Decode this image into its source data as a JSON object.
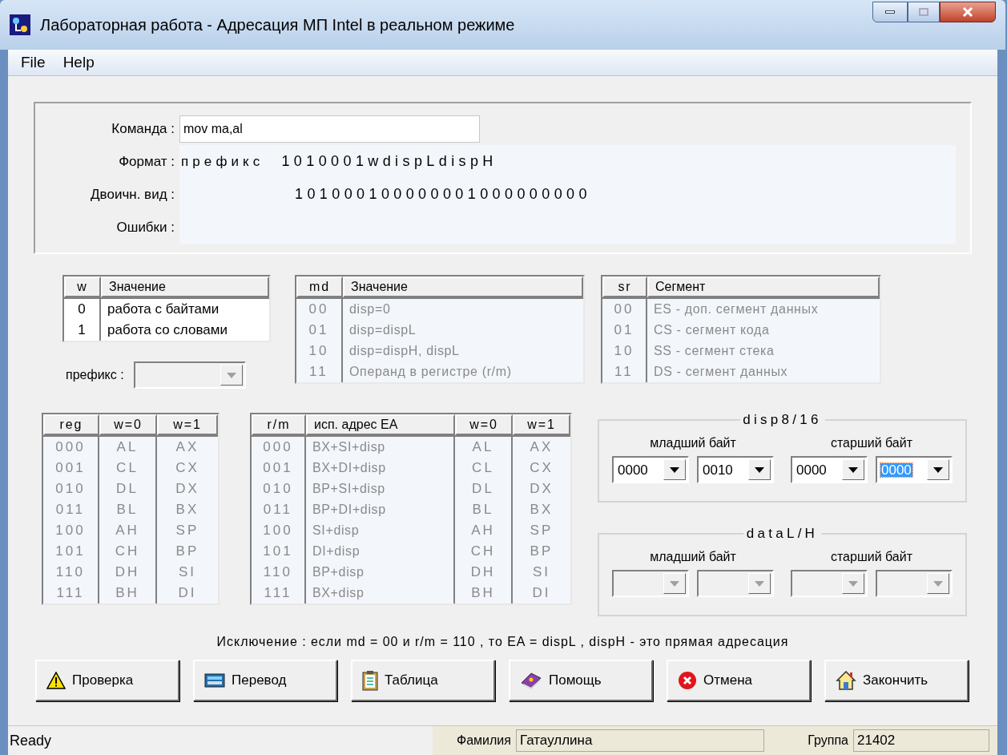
{
  "window": {
    "title": "Лабораторная работа - Адресация МП Intel в реальном режиме"
  },
  "menu": [
    "File",
    "Help"
  ],
  "command": {
    "label": "Команда :",
    "value": "mov ma,al"
  },
  "format": {
    "label": "Формат :",
    "prefix": "префикс",
    "value": "1010001wdispLdispH"
  },
  "binary": {
    "label": "Двоичн. вид :",
    "value": "101000100000001000000000"
  },
  "errors": {
    "label": "Ошибки :"
  },
  "w_table": {
    "disabled": false,
    "columns": [
      "w",
      "Значение"
    ],
    "rows": [
      [
        "0",
        "работа с байтами"
      ],
      [
        "1",
        "работа со словами"
      ]
    ]
  },
  "md_table": {
    "disabled": true,
    "columns": [
      "md",
      "Значение"
    ],
    "rows": [
      [
        "00",
        "disp=0"
      ],
      [
        "01",
        "disp=dispL"
      ],
      [
        "10",
        "disp=dispH, dispL"
      ],
      [
        "11",
        "Операнд в регистре (r/m)"
      ]
    ]
  },
  "sr_table": {
    "disabled": true,
    "columns": [
      "sr",
      "Сегмент"
    ],
    "rows": [
      [
        "00",
        "ES - доп. сегмент данных"
      ],
      [
        "01",
        "CS - сегмент кода"
      ],
      [
        "10",
        "SS - сегмент стека"
      ],
      [
        "11",
        "DS - сегмент данных"
      ]
    ]
  },
  "prefix": {
    "label": "префикс :",
    "disabled": true
  },
  "reg_table": {
    "disabled": true,
    "columns": [
      "reg",
      "w=0",
      "w=1"
    ],
    "rows": [
      [
        "000",
        "AL",
        "AX"
      ],
      [
        "001",
        "CL",
        "CX"
      ],
      [
        "010",
        "DL",
        "DX"
      ],
      [
        "011",
        "BL",
        "BX"
      ],
      [
        "100",
        "AH",
        "SP"
      ],
      [
        "101",
        "CH",
        "BP"
      ],
      [
        "110",
        "DH",
        "SI"
      ],
      [
        "111",
        "BH",
        "DI"
      ]
    ]
  },
  "rm_table": {
    "disabled": true,
    "columns": [
      "r/m",
      "исп. адрес EA",
      "w=0",
      "w=1"
    ],
    "rows": [
      [
        "000",
        "BX+SI+disp",
        "AL",
        "AX"
      ],
      [
        "001",
        "BX+DI+disp",
        "CL",
        "CX"
      ],
      [
        "010",
        "BP+SI+disp",
        "DL",
        "DX"
      ],
      [
        "011",
        "BP+DI+disp",
        "BL",
        "BX"
      ],
      [
        "100",
        "SI+disp",
        "AH",
        "SP"
      ],
      [
        "101",
        "DI+disp",
        "CH",
        "BP"
      ],
      [
        "110",
        "BP+disp",
        "DH",
        "SI"
      ],
      [
        "111",
        "BX+disp",
        "BH",
        "DI"
      ]
    ]
  },
  "disp": {
    "title": "disp8/16",
    "groups": [
      {
        "label": "младший байт",
        "combos": [
          {
            "value": "0000",
            "selected": false,
            "disabled": false
          },
          {
            "value": "0010",
            "selected": false,
            "disabled": false
          }
        ]
      },
      {
        "label": "старший байт",
        "combos": [
          {
            "value": "0000",
            "selected": false,
            "disabled": false
          },
          {
            "value": "0000",
            "selected": true,
            "disabled": false
          }
        ]
      }
    ]
  },
  "data": {
    "title": "dataL/H",
    "groups": [
      {
        "label": "младший байт",
        "combos": [
          {
            "disabled": true
          },
          {
            "disabled": true
          }
        ]
      },
      {
        "label": "старший байт",
        "combos": [
          {
            "disabled": true
          },
          {
            "disabled": true
          }
        ]
      }
    ]
  },
  "note": "Исключение : если md = 00 и r/m = 110 , то EA = dispL , dispH - это прямая адресация",
  "buttons": [
    {
      "label": "Проверка",
      "kind": "warning"
    },
    {
      "label": "Перевод",
      "kind": "calculator"
    },
    {
      "label": "Таблица",
      "kind": "clipboard"
    },
    {
      "label": "Помощь",
      "kind": "book"
    },
    {
      "label": "Отмена",
      "kind": "stop"
    },
    {
      "label": "Закончить",
      "kind": "house"
    }
  ],
  "status_bar": {
    "status": "Ready",
    "surname_label": "Фамилия",
    "surname": "Гатауллина",
    "group_label": "Группа",
    "group": "21402"
  }
}
